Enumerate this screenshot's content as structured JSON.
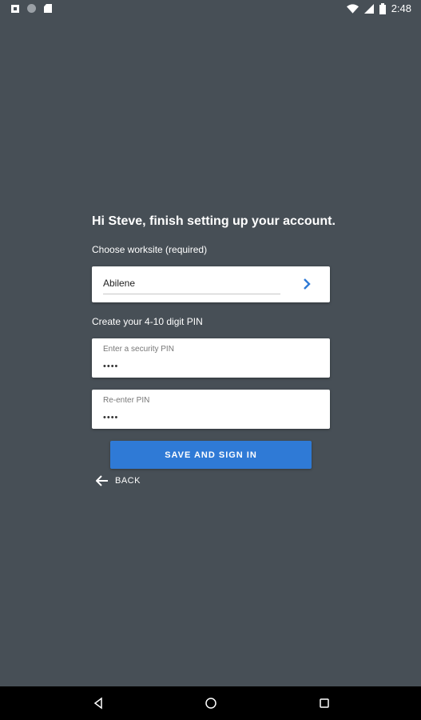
{
  "status_bar": {
    "time": "2:48",
    "icons": [
      "notification-icon",
      "circle-icon",
      "sd-card-icon",
      "wifi-icon",
      "signal-icon",
      "battery-icon"
    ]
  },
  "greeting": "Hi Steve, finish setting up your account.",
  "worksite": {
    "label": "Choose worksite (required)",
    "value": "Abilene",
    "icon": "chevron-right-icon"
  },
  "pin": {
    "label": "Create your 4-10 digit PIN",
    "field1": {
      "label": "Enter a security PIN",
      "value": "••••"
    },
    "field2": {
      "label": "Re-enter PIN",
      "value": "••••"
    }
  },
  "actions": {
    "save_label": "SAVE AND SIGN IN",
    "back_label": "BACK"
  },
  "colors": {
    "background": "#474f56",
    "accent": "#2f7ad6"
  },
  "nav_bar": {
    "icons": [
      "nav-back-icon",
      "nav-home-icon",
      "nav-recents-icon"
    ]
  }
}
